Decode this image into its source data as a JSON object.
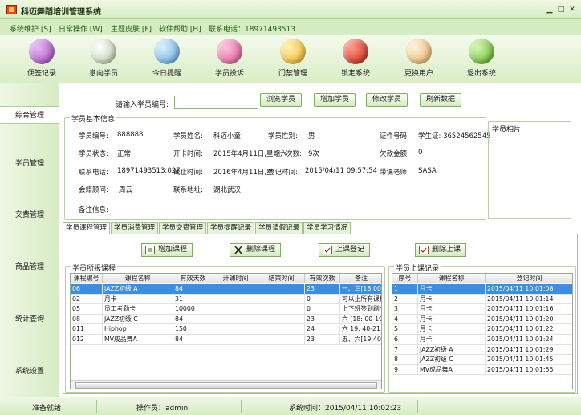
{
  "window": {
    "title": "科迈舞蹈培训管理系统"
  },
  "menu": [
    "系统维护 [S]",
    "日常操作 [W]",
    "主题皮肤 [F]",
    "软件帮助 [H]",
    "联系电话：18971493513"
  ],
  "toolbar": [
    {
      "label": "便签记录",
      "icon": "notepad-icon",
      "color": "#9a3db8"
    },
    {
      "label": "意向学员",
      "icon": "cd-icon",
      "color": "#c8d6b8"
    },
    {
      "label": "今日提醒",
      "icon": "calendar-icon",
      "color": "#6fb6e0"
    },
    {
      "label": "学员投诉",
      "icon": "feather-icon",
      "color": "#d84a8e"
    },
    {
      "label": "门禁管理",
      "icon": "smiley-icon",
      "color": "#f2c02e"
    },
    {
      "label": "锁定系统",
      "icon": "lock-icon",
      "color": "#d62a1e"
    },
    {
      "label": "更换用户",
      "icon": "document-icon",
      "color": "#f0c07a"
    },
    {
      "label": "退出系统",
      "icon": "exit-icon",
      "color": "#6ebf2a"
    }
  ],
  "sidebar": [
    "综合管理",
    "学员管理",
    "交费管理",
    "商品管理",
    "统计查询",
    "系统设置"
  ],
  "search": {
    "label": "请输入学员编号:",
    "value": "",
    "buttons": [
      "浏览学员",
      "增加学员",
      "修改学员",
      "刷新数据"
    ]
  },
  "basic": {
    "title": "学员基本信息",
    "photo_title": "学员相片",
    "fields": {
      "student_no_label": "学员编号:",
      "student_no": "888888",
      "name_label": "学员姓名:",
      "name": "科迈小童",
      "gender_label": "学员性别:",
      "gender": "男",
      "id_label": "证件号码:",
      "id": "学生证: 36524562545",
      "status_label": "学员状态:",
      "status": "正常",
      "start_label": "开卡时间:",
      "start": "2015年4月11日,星期六",
      "times_label": "次数:",
      "times": "9次",
      "debt_label": "欠款金额:",
      "debt": "0",
      "phone_label": "联系电话:",
      "phone": "18971493513;027-",
      "expire_label": "截止时间:",
      "expire": "2016年4月11日,星",
      "reg_label": "登记时间:",
      "reg": "2015/04/11 09:57:54",
      "teacher_label": "带课老师:",
      "teacher": "SASA",
      "consultant_label": "会籍顾问:",
      "consultant": "周云",
      "address_label": "联系地址:",
      "address": "湖北武汉",
      "remark_label": "备注信息:",
      "remark": ""
    }
  },
  "tabs": [
    "学员课程管理",
    "学员消费管理",
    "学员交费管理",
    "学员提醒记录",
    "学员请假记录",
    "学员学习情况"
  ],
  "actions": [
    "增加课程",
    "删除课程",
    "上课登记",
    "删除上课"
  ],
  "courses": {
    "title": "学员所报课程",
    "headers": [
      "课程编号",
      "课程名称",
      "有效天数",
      "开课时间",
      "结束时间",
      "有效次数",
      "备注"
    ],
    "rows": [
      [
        "06",
        "JAZZ初级 A",
        "84",
        "",
        "",
        "23",
        "一、三[18:00-"
      ],
      [
        "02",
        "月卡",
        "31",
        "",
        "",
        "0",
        "可以上所有课程"
      ],
      [
        "05",
        "员工考勤卡",
        "10000",
        "",
        "",
        "0",
        "上下班签到刷卡"
      ],
      [
        "08",
        "JAZZ初级 C",
        "84",
        "",
        "",
        "23",
        "六 (18: 00-19"
      ],
      [
        "011",
        "Hiphop",
        "150",
        "",
        "",
        "24",
        "六 19: 40-21:"
      ],
      [
        "012",
        "MV成品舞A",
        "84",
        "",
        "",
        "23",
        "五、六[19:40-"
      ]
    ]
  },
  "attendance": {
    "title": "学员上课记录",
    "headers": [
      "序号",
      "课程名称",
      "登记时间"
    ],
    "rows": [
      [
        "1",
        "月卡",
        "2015/04/11 10:01:08"
      ],
      [
        "2",
        "月卡",
        "2015/04/11 10:01:14"
      ],
      [
        "3",
        "月卡",
        "2015/04/11 10:01:16"
      ],
      [
        "4",
        "月卡",
        "2015/04/11 10:01:20"
      ],
      [
        "5",
        "月卡",
        "2015/04/11 10:01:22"
      ],
      [
        "6",
        "月卡",
        "2015/04/11 10:01:24"
      ],
      [
        "7",
        "JAZZ初级 A",
        "2015/04/11 10:01:29"
      ],
      [
        "8",
        "JAZZ初级 C",
        "2015/04/11 10:01:45"
      ],
      [
        "9",
        "MV成品舞A",
        "2015/04/11 10:01:55"
      ]
    ]
  },
  "status": {
    "ready": "准备就绪",
    "operator": "操作员：admin",
    "time": "系统时间：2015/04/11 10:02:23"
  },
  "colors": {
    "accent": "#3d8de0",
    "bar": "#d6ecc2"
  }
}
